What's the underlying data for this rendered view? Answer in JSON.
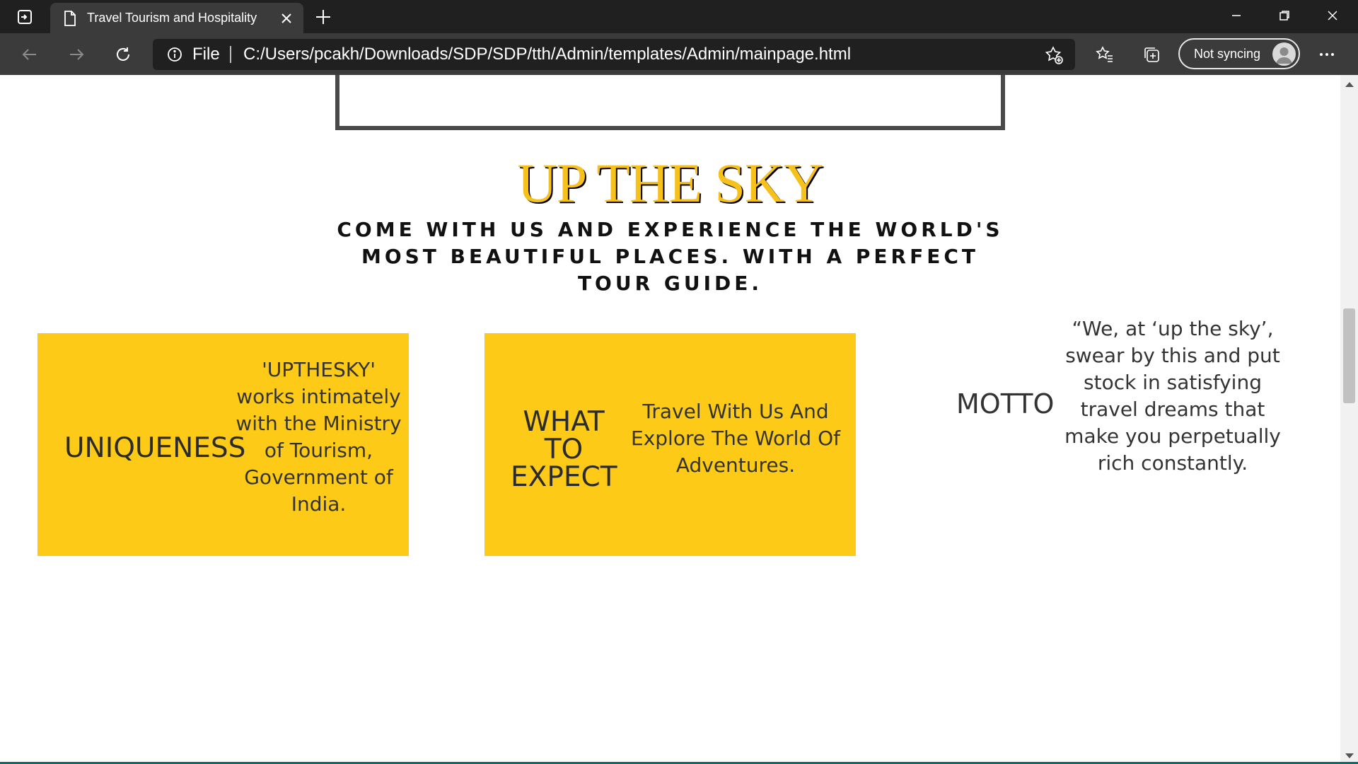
{
  "browser": {
    "tab_title": "Travel Tourism and Hospitality",
    "address": {
      "scheme_label": "File",
      "url": "C:/Users/pcakh/Downloads/SDP/SDP/tth/Admin/templates/Admin/mainpage.html"
    },
    "profile": {
      "label": "Not syncing"
    },
    "icons": {
      "tab_actions": "tab-actions-icon",
      "page": "page-icon",
      "close": "close-icon",
      "new_tab": "plus-icon",
      "back": "back-arrow-icon",
      "forward": "forward-arrow-icon",
      "refresh": "refresh-icon",
      "info": "info-icon",
      "add_favorite": "star-plus-icon",
      "favorites": "favorites-icon",
      "collections": "collections-icon",
      "more": "more-icon"
    }
  },
  "page": {
    "hero": {
      "title": "UP THE SKY",
      "subtitle": "COME WITH US AND EXPERIENCE THE WORLD'S MOST BEAUTIFUL PLACES. WITH A PERFECT TOUR GUIDE."
    },
    "cards": [
      {
        "heading": "UNIQUENESS",
        "text": "'UPTHESKY' works intimately with the Ministry of Tourism, Government of India."
      },
      {
        "heading": "WHAT TO EXPECT",
        "text": "Travel With Us And Explore The World Of Adventures."
      }
    ],
    "motto": {
      "heading": "MOTTO",
      "text": "“We, at ‘up the sky’, swear by this and put stock in satisfying travel dreams that make you perpetually rich constantly."
    }
  },
  "colors": {
    "accent_yellow": "#fdcb17",
    "title_yellow": "#f6c11b",
    "chrome_dark": "#202020",
    "chrome_mid": "#3b3b3b"
  }
}
